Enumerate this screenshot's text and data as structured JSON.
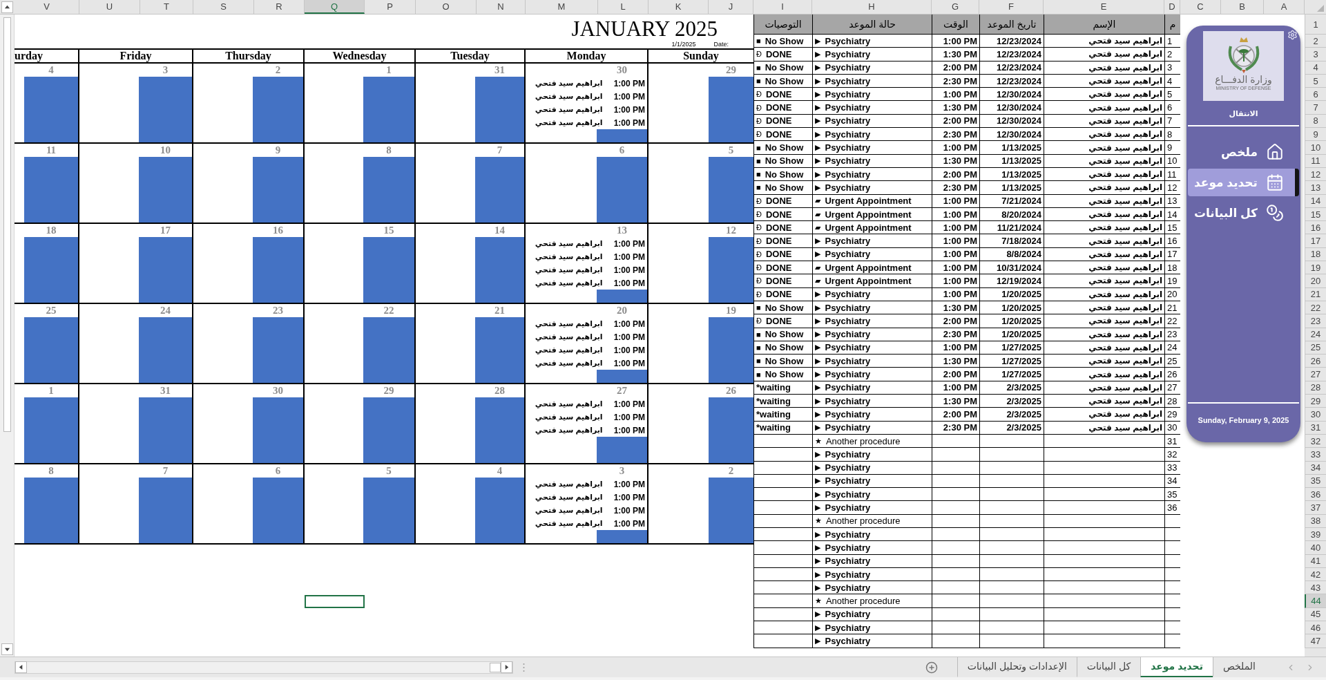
{
  "column_headers": [
    {
      "label": "V",
      "selected": false
    },
    {
      "label": "U",
      "selected": false
    },
    {
      "label": "T",
      "selected": false
    },
    {
      "label": "S",
      "selected": false
    },
    {
      "label": "R",
      "selected": false
    },
    {
      "label": "Q",
      "selected": true
    },
    {
      "label": "P",
      "selected": false
    },
    {
      "label": "O",
      "selected": false
    },
    {
      "label": "N",
      "selected": false
    },
    {
      "label": "M",
      "selected": false
    },
    {
      "label": "L",
      "selected": false
    },
    {
      "label": "K",
      "selected": false
    },
    {
      "label": "J",
      "selected": false
    },
    {
      "label": "I",
      "selected": false
    },
    {
      "label": "H",
      "selected": false
    },
    {
      "label": "G",
      "selected": false
    },
    {
      "label": "F",
      "selected": false
    },
    {
      "label": "E",
      "selected": false
    },
    {
      "label": "D",
      "selected": false
    },
    {
      "label": "C",
      "selected": false
    },
    {
      "label": "B",
      "selected": false
    },
    {
      "label": "A",
      "selected": false
    }
  ],
  "row_headers": [
    {
      "label": "1",
      "selected": false
    },
    {
      "label": "2",
      "selected": false
    },
    {
      "label": "3",
      "selected": false
    },
    {
      "label": "4",
      "selected": false
    },
    {
      "label": "5",
      "selected": false
    },
    {
      "label": "6",
      "selected": false
    },
    {
      "label": "7",
      "selected": false
    },
    {
      "label": "8",
      "selected": false
    },
    {
      "label": "9",
      "selected": false
    },
    {
      "label": "10",
      "selected": false
    },
    {
      "label": "11",
      "selected": false
    },
    {
      "label": "12",
      "selected": false
    },
    {
      "label": "13",
      "selected": false
    },
    {
      "label": "14",
      "selected": false
    },
    {
      "label": "15",
      "selected": false
    },
    {
      "label": "16",
      "selected": false
    },
    {
      "label": "17",
      "selected": false
    },
    {
      "label": "18",
      "selected": false
    },
    {
      "label": "19",
      "selected": false
    },
    {
      "label": "20",
      "selected": false
    },
    {
      "label": "21",
      "selected": false
    },
    {
      "label": "22",
      "selected": false
    },
    {
      "label": "23",
      "selected": false
    },
    {
      "label": "24",
      "selected": false
    },
    {
      "label": "25",
      "selected": false
    },
    {
      "label": "26",
      "selected": false
    },
    {
      "label": "27",
      "selected": false
    },
    {
      "label": "28",
      "selected": false
    },
    {
      "label": "29",
      "selected": false
    },
    {
      "label": "30",
      "selected": false
    },
    {
      "label": "31",
      "selected": false
    },
    {
      "label": "32",
      "selected": false
    },
    {
      "label": "33",
      "selected": false
    },
    {
      "label": "34",
      "selected": false
    },
    {
      "label": "35",
      "selected": false
    },
    {
      "label": "36",
      "selected": false
    },
    {
      "label": "37",
      "selected": false
    },
    {
      "label": "38",
      "selected": false
    },
    {
      "label": "39",
      "selected": false
    },
    {
      "label": "40",
      "selected": false
    },
    {
      "label": "41",
      "selected": false
    },
    {
      "label": "42",
      "selected": false
    },
    {
      "label": "43",
      "selected": false
    },
    {
      "label": "44",
      "selected": true
    },
    {
      "label": "45",
      "selected": false
    },
    {
      "label": "46",
      "selected": false
    },
    {
      "label": "47",
      "selected": false
    }
  ],
  "calendar": {
    "title": "JANUARY 2025",
    "date_label": "Date:",
    "date_value": "1/1/2025",
    "weekdays": [
      "urday",
      "Friday",
      "Thursday",
      "Wednesday",
      "Tuesday",
      "Monday",
      "Sunday"
    ],
    "weeks": [
      {
        "days": [
          {
            "day": "4"
          },
          {
            "day": "3"
          },
          {
            "day": "2"
          },
          {
            "day": "1"
          },
          {
            "day": "31"
          },
          {
            "day": "30",
            "appointments": [
              {
                "time": "1:00 PM",
                "name": "ابراهيم سيد فتحي"
              },
              {
                "time": "1:00 PM",
                "name": "ابراهيم سيد فتحي"
              },
              {
                "time": "1:00 PM",
                "name": "ابراهيم سيد فتحي"
              },
              {
                "time": "1:00 PM",
                "name": "ابراهيم سيد فتحي"
              }
            ]
          },
          {
            "day": "29"
          }
        ]
      },
      {
        "days": [
          {
            "day": "11"
          },
          {
            "day": "10"
          },
          {
            "day": "9"
          },
          {
            "day": "8"
          },
          {
            "day": "7"
          },
          {
            "day": "6"
          },
          {
            "day": "5"
          }
        ]
      },
      {
        "days": [
          {
            "day": "18"
          },
          {
            "day": "17"
          },
          {
            "day": "16"
          },
          {
            "day": "15"
          },
          {
            "day": "14"
          },
          {
            "day": "13",
            "appointments": [
              {
                "time": "1:00 PM",
                "name": "ابراهيم سيد فتحي"
              },
              {
                "time": "1:00 PM",
                "name": "ابراهيم سيد فتحي"
              },
              {
                "time": "1:00 PM",
                "name": "ابراهيم سيد فتحي"
              },
              {
                "time": "1:00 PM",
                "name": "ابراهيم سيد فتحي"
              }
            ]
          },
          {
            "day": "12"
          }
        ]
      },
      {
        "days": [
          {
            "day": "25"
          },
          {
            "day": "24"
          },
          {
            "day": "23"
          },
          {
            "day": "22"
          },
          {
            "day": "21"
          },
          {
            "day": "20",
            "appointments": [
              {
                "time": "1:00 PM",
                "name": "ابراهيم سيد فتحي"
              },
              {
                "time": "1:00 PM",
                "name": "ابراهيم سيد فتحي"
              },
              {
                "time": "1:00 PM",
                "name": "ابراهيم سيد فتحي"
              },
              {
                "time": "1:00 PM",
                "name": "ابراهيم سيد فتحي"
              }
            ]
          },
          {
            "day": "19"
          }
        ]
      },
      {
        "days": [
          {
            "day": "1"
          },
          {
            "day": "31"
          },
          {
            "day": "30"
          },
          {
            "day": "29"
          },
          {
            "day": "28"
          },
          {
            "day": "27",
            "appointments": [
              {
                "time": "1:00 PM",
                "name": "ابراهيم سيد فتحي"
              },
              {
                "time": "1:00 PM",
                "name": "ابراهيم سيد فتحي"
              },
              {
                "time": "1:00 PM",
                "name": "ابراهيم سيد فتحي"
              }
            ]
          },
          {
            "day": "26"
          }
        ]
      },
      {
        "days": [
          {
            "day": "8"
          },
          {
            "day": "7"
          },
          {
            "day": "6"
          },
          {
            "day": "5"
          },
          {
            "day": "4"
          },
          {
            "day": "3",
            "appointments": [
              {
                "time": "1:00 PM",
                "name": "ابراهيم سيد فتحي"
              },
              {
                "time": "1:00 PM",
                "name": "ابراهيم سيد فتحي"
              },
              {
                "time": "1:00 PM",
                "name": "ابراهيم سيد فتحي"
              },
              {
                "time": "1:00 PM",
                "name": "ابراهيم سيد فتحي"
              }
            ]
          },
          {
            "day": "2"
          }
        ]
      }
    ]
  },
  "table": {
    "columns": [
      "م",
      "الإسم",
      "تاريخ الموعد",
      "الوقت",
      "حالة الموعد",
      "التوصيات"
    ],
    "rows": [
      {
        "num": "1",
        "name": "ابراهيم سيد فتحي",
        "date": "12/23/2024",
        "time": "1:00 PM",
        "procedure": {
          "kind": "psychiatry",
          "icon": "▶",
          "text": "Psychiatry"
        },
        "result": {
          "icon": "■",
          "text": "No Show"
        }
      },
      {
        "num": "2",
        "name": "ابراهيم سيد فتحي",
        "date": "12/23/2024",
        "time": "1:30 PM",
        "procedure": {
          "kind": "psychiatry",
          "icon": "▶",
          "text": "Psychiatry"
        },
        "result": {
          "icon": "Ð",
          "text": "DONE"
        }
      },
      {
        "num": "3",
        "name": "ابراهيم سيد فتحي",
        "date": "12/23/2024",
        "time": "2:00 PM",
        "procedure": {
          "kind": "psychiatry",
          "icon": "▶",
          "text": "Psychiatry"
        },
        "result": {
          "icon": "■",
          "text": "No Show"
        }
      },
      {
        "num": "4",
        "name": "ابراهيم سيد فتحي",
        "date": "12/23/2024",
        "time": "2:30 PM",
        "procedure": {
          "kind": "psychiatry",
          "icon": "▶",
          "text": "Psychiatry"
        },
        "result": {
          "icon": "■",
          "text": "No Show"
        }
      },
      {
        "num": "5",
        "name": "ابراهيم سيد فتحي",
        "date": "12/30/2024",
        "time": "1:00 PM",
        "procedure": {
          "kind": "psychiatry",
          "icon": "▶",
          "text": "Psychiatry"
        },
        "result": {
          "icon": "Ð",
          "text": "DONE"
        }
      },
      {
        "num": "6",
        "name": "ابراهيم سيد فتحي",
        "date": "12/30/2024",
        "time": "1:30 PM",
        "procedure": {
          "kind": "psychiatry",
          "icon": "▶",
          "text": "Psychiatry"
        },
        "result": {
          "icon": "Ð",
          "text": "DONE"
        }
      },
      {
        "num": "7",
        "name": "ابراهيم سيد فتحي",
        "date": "12/30/2024",
        "time": "2:00 PM",
        "procedure": {
          "kind": "psychiatry",
          "icon": "▶",
          "text": "Psychiatry"
        },
        "result": {
          "icon": "Ð",
          "text": "DONE"
        }
      },
      {
        "num": "8",
        "name": "ابراهيم سيد فتحي",
        "date": "12/30/2024",
        "time": "2:30 PM",
        "procedure": {
          "kind": "psychiatry",
          "icon": "▶",
          "text": "Psychiatry"
        },
        "result": {
          "icon": "Ð",
          "text": "DONE"
        }
      },
      {
        "num": "9",
        "name": "ابراهيم سيد فتحي",
        "date": "1/13/2025",
        "time": "1:00 PM",
        "procedure": {
          "kind": "psychiatry",
          "icon": "▶",
          "text": "Psychiatry"
        },
        "result": {
          "icon": "■",
          "text": "No Show"
        }
      },
      {
        "num": "10",
        "name": "ابراهيم سيد فتحي",
        "date": "1/13/2025",
        "time": "1:30 PM",
        "procedure": {
          "kind": "psychiatry",
          "icon": "▶",
          "text": "Psychiatry"
        },
        "result": {
          "icon": "■",
          "text": "No Show"
        }
      },
      {
        "num": "11",
        "name": "ابراهيم سيد فتحي",
        "date": "1/13/2025",
        "time": "2:00 PM",
        "procedure": {
          "kind": "psychiatry",
          "icon": "▶",
          "text": "Psychiatry"
        },
        "result": {
          "icon": "■",
          "text": "No Show"
        }
      },
      {
        "num": "12",
        "name": "ابراهيم سيد فتحي",
        "date": "1/13/2025",
        "time": "2:30 PM",
        "procedure": {
          "kind": "psychiatry",
          "icon": "▶",
          "text": "Psychiatry"
        },
        "result": {
          "icon": "■",
          "text": "No Show"
        }
      },
      {
        "num": "13",
        "name": "ابراهيم سيد فتحي",
        "date": "7/21/2024",
        "time": "1:00 PM",
        "procedure": {
          "kind": "urgent",
          "icon": "▰",
          "text": "Urgent Appointment"
        },
        "result": {
          "icon": "Ð",
          "text": "DONE"
        }
      },
      {
        "num": "14",
        "name": "ابراهيم سيد فتحي",
        "date": "8/20/2024",
        "time": "1:00 PM",
        "procedure": {
          "kind": "urgent",
          "icon": "▰",
          "text": "Urgent Appointment"
        },
        "result": {
          "icon": "Ð",
          "text": "DONE"
        }
      },
      {
        "num": "15",
        "name": "ابراهيم سيد فتحي",
        "date": "11/21/2024",
        "time": "1:00 PM",
        "procedure": {
          "kind": "urgent",
          "icon": "▰",
          "text": "Urgent Appointment"
        },
        "result": {
          "icon": "Ð",
          "text": "DONE"
        }
      },
      {
        "num": "16",
        "name": "ابراهيم سيد فتحي",
        "date": "7/18/2024",
        "time": "1:00 PM",
        "procedure": {
          "kind": "psychiatry",
          "icon": "▶",
          "text": "Psychiatry"
        },
        "result": {
          "icon": "Ð",
          "text": "DONE"
        }
      },
      {
        "num": "17",
        "name": "ابراهيم سيد فتحي",
        "date": "8/8/2024",
        "time": "1:00 PM",
        "procedure": {
          "kind": "psychiatry",
          "icon": "▶",
          "text": "Psychiatry"
        },
        "result": {
          "icon": "Ð",
          "text": "DONE"
        }
      },
      {
        "num": "18",
        "name": "ابراهيم سيد فتحي",
        "date": "10/31/2024",
        "time": "1:00 PM",
        "procedure": {
          "kind": "urgent",
          "icon": "▰",
          "text": "Urgent Appointment"
        },
        "result": {
          "icon": "Ð",
          "text": "DONE"
        }
      },
      {
        "num": "19",
        "name": "ابراهيم سيد فتحي",
        "date": "12/19/2024",
        "time": "1:00 PM",
        "procedure": {
          "kind": "urgent",
          "icon": "▰",
          "text": "Urgent Appointment"
        },
        "result": {
          "icon": "Ð",
          "text": "DONE"
        }
      },
      {
        "num": "20",
        "name": "ابراهيم سيد فتحي",
        "date": "1/20/2025",
        "time": "1:00 PM",
        "procedure": {
          "kind": "psychiatry",
          "icon": "▶",
          "text": "Psychiatry"
        },
        "result": {
          "icon": "Ð",
          "text": "DONE"
        }
      },
      {
        "num": "21",
        "name": "ابراهيم سيد فتحي",
        "date": "1/20/2025",
        "time": "1:30 PM",
        "procedure": {
          "kind": "psychiatry",
          "icon": "▶",
          "text": "Psychiatry"
        },
        "result": {
          "icon": "■",
          "text": "No Show"
        }
      },
      {
        "num": "22",
        "name": "ابراهيم سيد فتحي",
        "date": "1/20/2025",
        "time": "2:00 PM",
        "procedure": {
          "kind": "psychiatry",
          "icon": "▶",
          "text": "Psychiatry"
        },
        "result": {
          "icon": "Ð",
          "text": "DONE"
        }
      },
      {
        "num": "23",
        "name": "ابراهيم سيد فتحي",
        "date": "1/20/2025",
        "time": "2:30 PM",
        "procedure": {
          "kind": "psychiatry",
          "icon": "▶",
          "text": "Psychiatry"
        },
        "result": {
          "icon": "■",
          "text": "No Show"
        }
      },
      {
        "num": "24",
        "name": "ابراهيم سيد فتحي",
        "date": "1/27/2025",
        "time": "1:00 PM",
        "procedure": {
          "kind": "psychiatry",
          "icon": "▶",
          "text": "Psychiatry"
        },
        "result": {
          "icon": "■",
          "text": "No Show"
        }
      },
      {
        "num": "25",
        "name": "ابراهيم سيد فتحي",
        "date": "1/27/2025",
        "time": "1:30 PM",
        "procedure": {
          "kind": "psychiatry",
          "icon": "▶",
          "text": "Psychiatry"
        },
        "result": {
          "icon": "■",
          "text": "No Show"
        }
      },
      {
        "num": "26",
        "name": "ابراهيم سيد فتحي",
        "date": "1/27/2025",
        "time": "2:00 PM",
        "procedure": {
          "kind": "psychiatry",
          "icon": "▶",
          "text": "Psychiatry"
        },
        "result": {
          "icon": "■",
          "text": "No Show"
        }
      },
      {
        "num": "27",
        "name": "ابراهيم سيد فتحي",
        "date": "2/3/2025",
        "time": "1:00 PM",
        "procedure": {
          "kind": "psychiatry",
          "icon": "▶",
          "text": "Psychiatry"
        },
        "result": {
          "text": "*waiting"
        }
      },
      {
        "num": "28",
        "name": "ابراهيم سيد فتحي",
        "date": "2/3/2025",
        "time": "1:30 PM",
        "procedure": {
          "kind": "psychiatry",
          "icon": "▶",
          "text": "Psychiatry"
        },
        "result": {
          "text": "*waiting"
        }
      },
      {
        "num": "29",
        "name": "ابراهيم سيد فتحي",
        "date": "2/3/2025",
        "time": "2:00 PM",
        "procedure": {
          "kind": "psychiatry",
          "icon": "▶",
          "text": "Psychiatry"
        },
        "result": {
          "text": "*waiting"
        }
      },
      {
        "num": "30",
        "name": "ابراهيم سيد فتحي",
        "date": "2/3/2025",
        "time": "2:30 PM",
        "procedure": {
          "kind": "psychiatry",
          "icon": "▶",
          "text": "Psychiatry"
        },
        "result": {
          "text": "*waiting"
        }
      },
      {
        "num": "31",
        "procedure": {
          "kind": "other",
          "icon": "★",
          "text": "Another procedure"
        }
      },
      {
        "num": "32",
        "procedure": {
          "kind": "psychiatry",
          "icon": "▶",
          "text": "Psychiatry"
        }
      },
      {
        "num": "33",
        "procedure": {
          "kind": "psychiatry",
          "icon": "▶",
          "text": "Psychiatry"
        }
      },
      {
        "num": "34",
        "procedure": {
          "kind": "psychiatry",
          "icon": "▶",
          "text": "Psychiatry"
        }
      },
      {
        "num": "35",
        "procedure": {
          "kind": "psychiatry",
          "icon": "▶",
          "text": "Psychiatry"
        }
      },
      {
        "num": "36",
        "procedure": {
          "kind": "psychiatry",
          "icon": "▶",
          "text": "Psychiatry"
        }
      },
      {
        "procedure": {
          "kind": "other",
          "icon": "★",
          "text": "Another procedure"
        }
      },
      {
        "procedure": {
          "kind": "psychiatry",
          "icon": "▶",
          "text": "Psychiatry"
        }
      },
      {
        "procedure": {
          "kind": "psychiatry",
          "icon": "▶",
          "text": "Psychiatry"
        }
      },
      {
        "procedure": {
          "kind": "psychiatry",
          "icon": "▶",
          "text": "Psychiatry"
        }
      },
      {
        "procedure": {
          "kind": "psychiatry",
          "icon": "▶",
          "text": "Psychiatry"
        }
      },
      {
        "procedure": {
          "kind": "psychiatry",
          "icon": "▶",
          "text": "Psychiatry"
        }
      },
      {
        "procedure": {
          "kind": "other",
          "icon": "★",
          "text": "Another procedure"
        }
      },
      {
        "procedure": {
          "kind": "psychiatry",
          "icon": "▶",
          "text": "Psychiatry"
        }
      },
      {
        "procedure": {
          "kind": "psychiatry",
          "icon": "▶",
          "text": "Psychiatry"
        }
      },
      {
        "procedure": {
          "kind": "psychiatry",
          "icon": "▶",
          "text": "Psychiatry"
        }
      }
    ]
  },
  "sidebar": {
    "logo_arabic": "وزارة الدفـــاع",
    "logo_english": "MINISTRY OF DEFENSE",
    "nav_title": "الانتقال",
    "items": [
      {
        "kind": "home",
        "label": "ملخص",
        "selected": false
      },
      {
        "kind": "calendar",
        "label": "تحديد موعد",
        "selected": true
      },
      {
        "kind": "data",
        "label": "كل البيانات",
        "selected": false
      }
    ],
    "date": "Sunday, February 9, 2025"
  },
  "sheet_tabs": [
    {
      "label": "الملخص",
      "selected": false
    },
    {
      "label": "تحديد موعد",
      "selected": true
    },
    {
      "label": "كل البيانات",
      "selected": false
    },
    {
      "label": "الإعدادات وتحليل البيانات",
      "selected": false
    }
  ]
}
